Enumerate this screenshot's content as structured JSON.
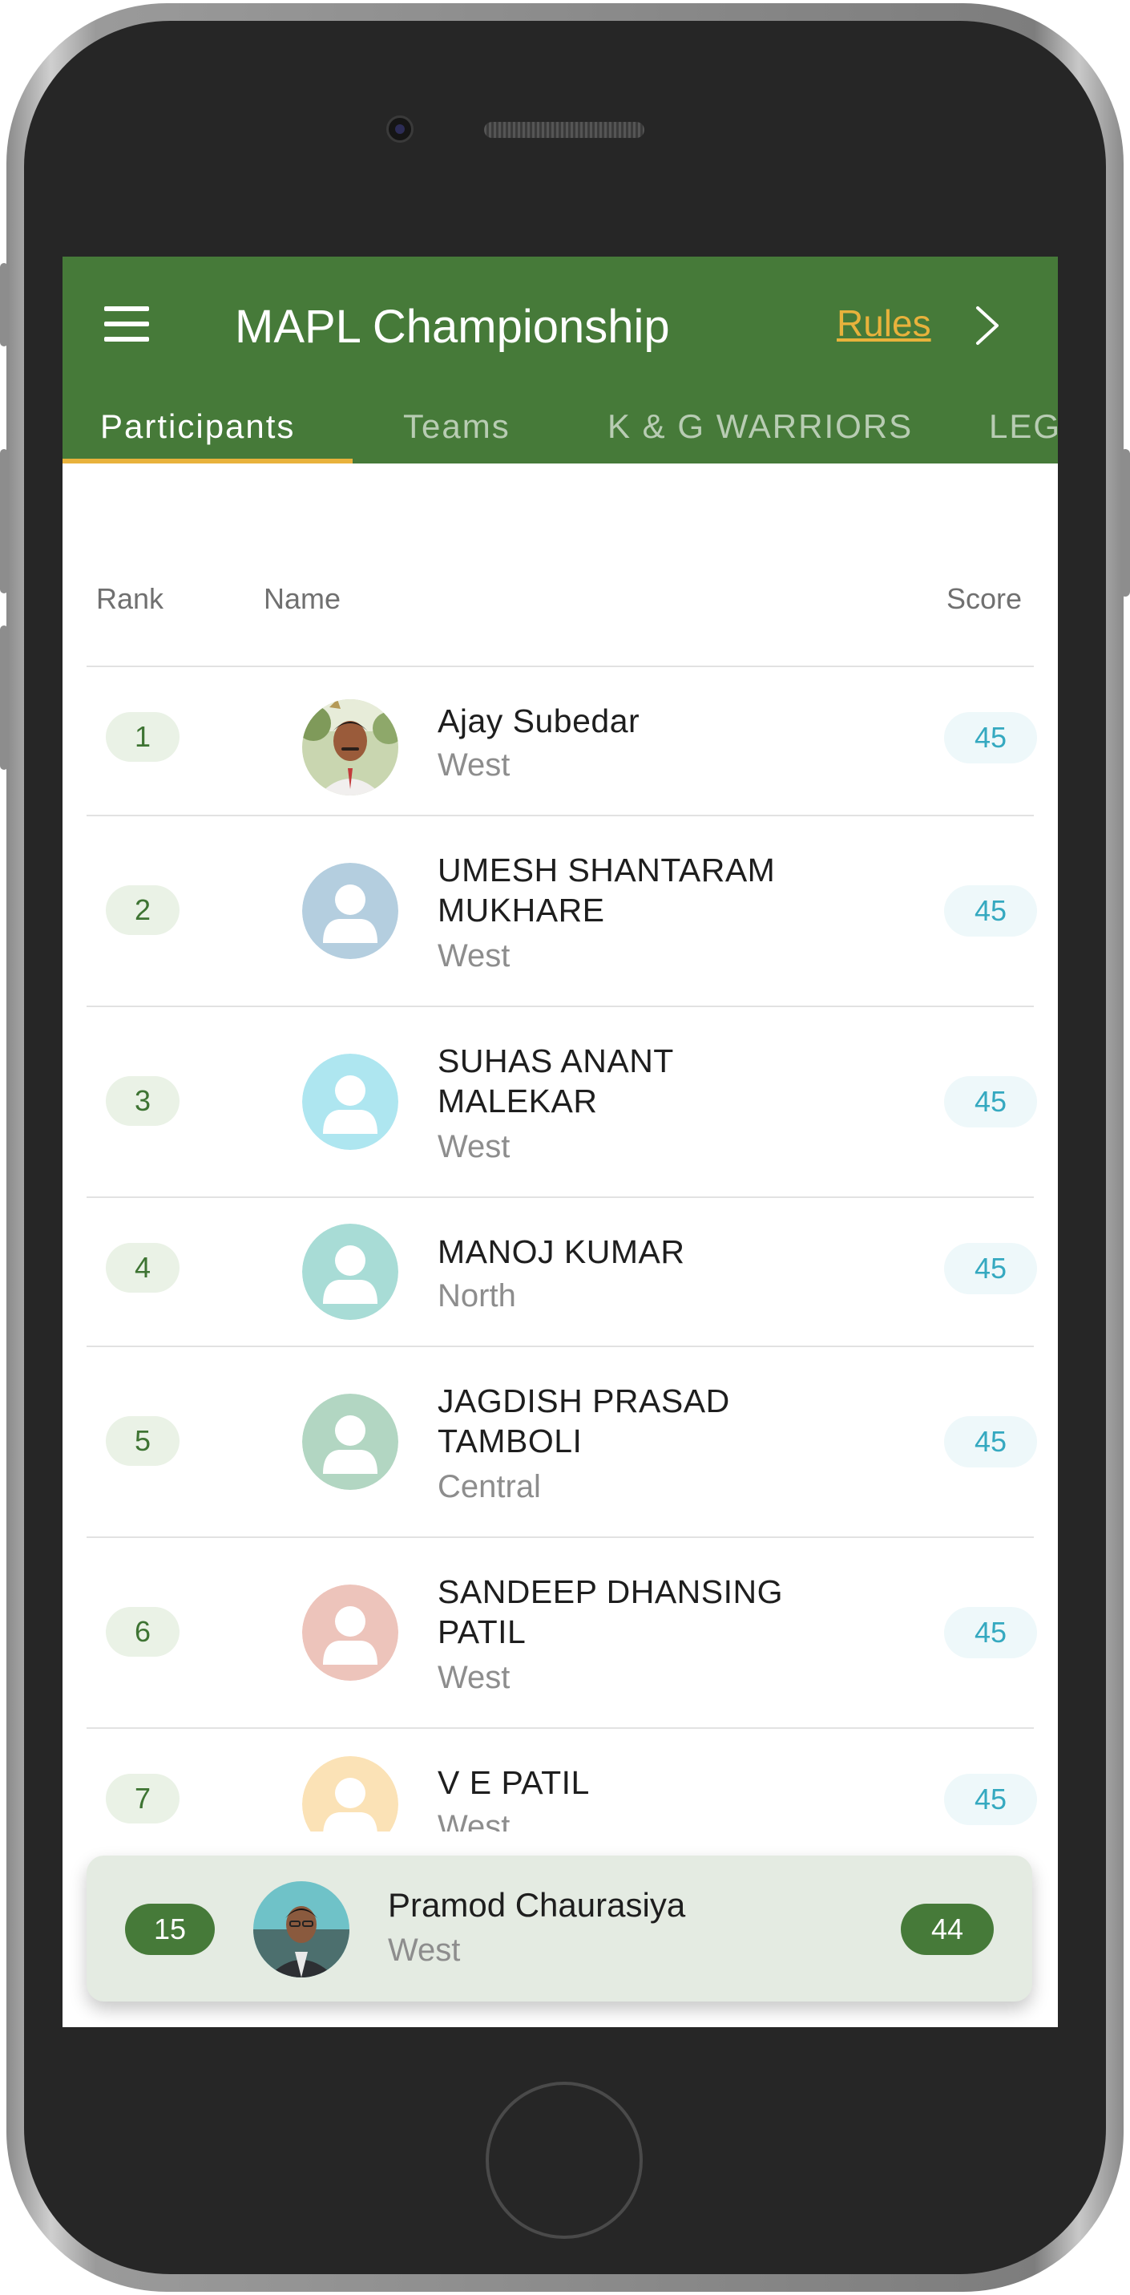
{
  "header": {
    "title": "MAPL Championship",
    "rules_label": "Rules"
  },
  "tabs": [
    {
      "label": "Participants",
      "active": true
    },
    {
      "label": "Teams",
      "active": false
    },
    {
      "label": "K & G WARRIORS",
      "active": false
    },
    {
      "label": "LEG",
      "active": false
    }
  ],
  "columns": {
    "rank": "Rank",
    "name": "Name",
    "score": "Score"
  },
  "leaderboard": [
    {
      "rank": "1",
      "name": "Ajay Subedar",
      "region": "West",
      "score": "45",
      "avatar": "photo"
    },
    {
      "rank": "2",
      "name": "UMESH SHANTARAM MUKHARE",
      "region": "West",
      "score": "45",
      "avatar": "placeholder",
      "avatar_color": "#b4cedf"
    },
    {
      "rank": "3",
      "name": "SUHAS ANANT MALEKAR",
      "region": "West",
      "score": "45",
      "avatar": "placeholder",
      "avatar_color": "#aee6f0"
    },
    {
      "rank": "4",
      "name": "MANOJ KUMAR",
      "region": "North",
      "score": "45",
      "avatar": "placeholder",
      "avatar_color": "#a8dcd6"
    },
    {
      "rank": "5",
      "name": "JAGDISH PRASAD TAMBOLI",
      "region": "Central",
      "score": "45",
      "avatar": "placeholder",
      "avatar_color": "#b2d6c2"
    },
    {
      "rank": "6",
      "name": "SANDEEP DHANSING PATIL",
      "region": "West",
      "score": "45",
      "avatar": "placeholder",
      "avatar_color": "#edc4bb"
    },
    {
      "rank": "7",
      "name": "V E PATIL",
      "region": "West",
      "score": "45",
      "avatar": "placeholder",
      "avatar_color": "#fbe2b6"
    }
  ],
  "current_user": {
    "rank": "15",
    "name": "Pramod Chaurasiya",
    "region": "West",
    "score": "44"
  },
  "colors": {
    "primary": "#467a39",
    "accent": "#e8b23c",
    "score_text": "#35a9c0",
    "rank_bg": "#eaf2e6"
  },
  "icons": {
    "menu": "hamburger-menu-icon",
    "next": "chevron-right-icon",
    "avatar": "person-placeholder-icon"
  }
}
